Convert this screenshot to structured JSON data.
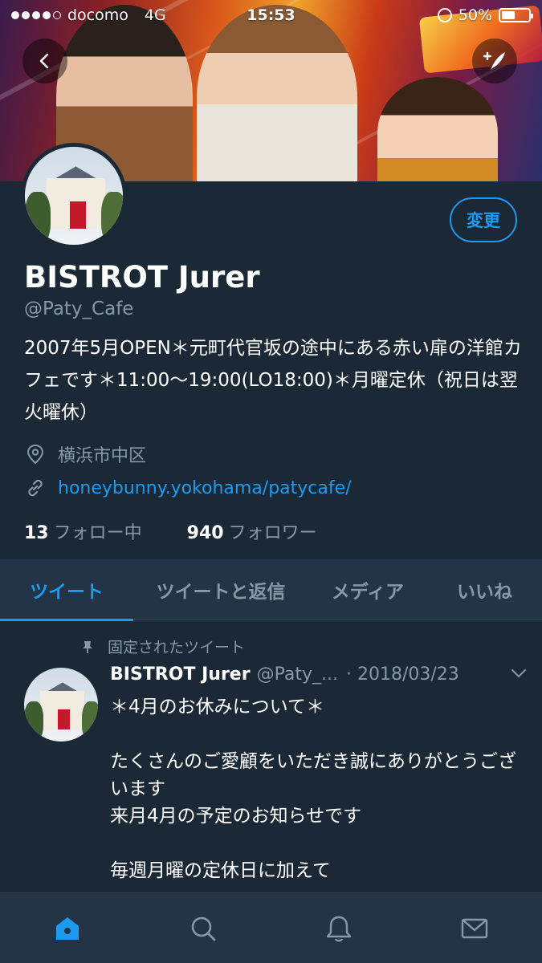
{
  "status": {
    "carrier": "docomo",
    "network": "4G",
    "time": "15:53",
    "battery": "50%",
    "battery_level": 0.5
  },
  "profile": {
    "name": "BISTROT Jurer",
    "handle": "@Paty_Cafe",
    "edit_label": "変更",
    "bio": "2007年5月OPEN＊元町代官坂の途中にある赤い扉の洋館カフェです＊11:00〜19:00(LO18:00)＊月曜定休（祝日は翌火曜休）",
    "location": "横浜市中区",
    "url": "honeybunny.yokohama/patycafe/",
    "following_count": "13",
    "following_label": "フォロー中",
    "followers_count": "940",
    "followers_label": "フォロワー"
  },
  "tabs": [
    {
      "label": "ツイート",
      "active": true
    },
    {
      "label": "ツイートと返信",
      "active": false
    },
    {
      "label": "メディア",
      "active": false
    },
    {
      "label": "いいね",
      "active": false
    }
  ],
  "tweet": {
    "pinned_label": "固定されたツイート",
    "name": "BISTROT Jurer",
    "handle": "@Paty_...",
    "date": "· 2018/03/23",
    "text": "＊4月のお休みについて＊\n\nたくさんのご愛顧をいただき誠にありがとうございます\n来月4月の予定のお知らせです\n\n毎週月曜の定休日に加えて"
  },
  "icons": {
    "back": "chevron-left-icon",
    "compose": "compose-icon",
    "location": "location-pin-icon",
    "link": "link-icon",
    "pin": "pin-icon",
    "home": "home-icon",
    "search": "search-icon",
    "notifications": "bell-icon",
    "messages": "mail-icon"
  },
  "colors": {
    "background": "#1b2836",
    "accent": "#1d9bf0",
    "muted": "#8899a6",
    "bar": "#243447"
  }
}
